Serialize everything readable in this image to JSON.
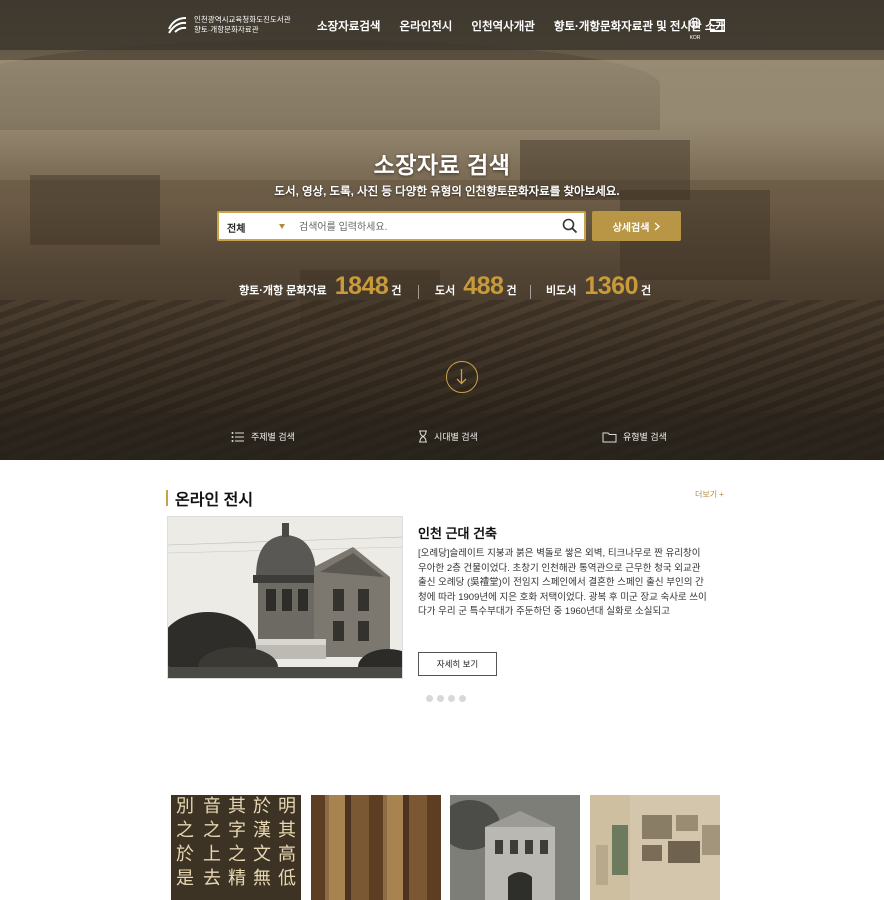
{
  "header": {
    "logo_line1": "인천광역시교육청화도진도서관",
    "logo_line2": "향토·개항문화자료관",
    "nav": [
      "소장자료검색",
      "온라인전시",
      "인천역사개관",
      "향토·개항문화자료관 및 전시관 소개"
    ],
    "lang_label": "KOR"
  },
  "hero": {
    "title": "소장자료 검색",
    "subtitle": "도서, 영상, 도록, 사진 등 다양한 유형의 인천향토문화자료를 찾아보세요.",
    "search": {
      "category": "전체",
      "placeholder": "검색어를 입력하세요."
    },
    "advanced_search_label": "상세검색",
    "stats": [
      {
        "label": "향토·개항 문화자료",
        "value": "1848",
        "unit": "건"
      },
      {
        "label": "도서",
        "value": "488",
        "unit": "건"
      },
      {
        "label": "비도서",
        "value": "1360",
        "unit": "건"
      }
    ],
    "subnav": [
      "주제별 검색",
      "시대별 검색",
      "유형별 검색"
    ]
  },
  "exhibit": {
    "section_title": "온라인 전시",
    "more_label": "더보기 +",
    "title": "인천 근대 건축",
    "description": "[오례당]슬레이트 지붕과 붉은 벽돌로 쌓은 외벽, 티크나무로 짠 유리창이 우아한 2층 건물이었다. 초창기 인천해관 통역관으로 근무한 청국 외교관 출신 오례당 (吳禮堂)이 전임지 스페인에서 결혼한 스페인 출신 부인의 간청에 따라 1909년에 지은 호화 저택이었다. 광복 후 미군 장교 숙사로 쓰이다가 우리 군 특수부대가 주둔하던 중 1960년대 실화로 소실되고",
    "detail_label": "자세히 보기",
    "slide_count": 4
  },
  "thumbnails": {
    "calligraphy_columns": [
      "明其高低",
      "於漢文無",
      "其字之精",
      "音之上去",
      "別之於是"
    ]
  },
  "colors": {
    "accent": "#c9a24a",
    "button": "#b89645",
    "stat_number": "#c89a3a"
  }
}
